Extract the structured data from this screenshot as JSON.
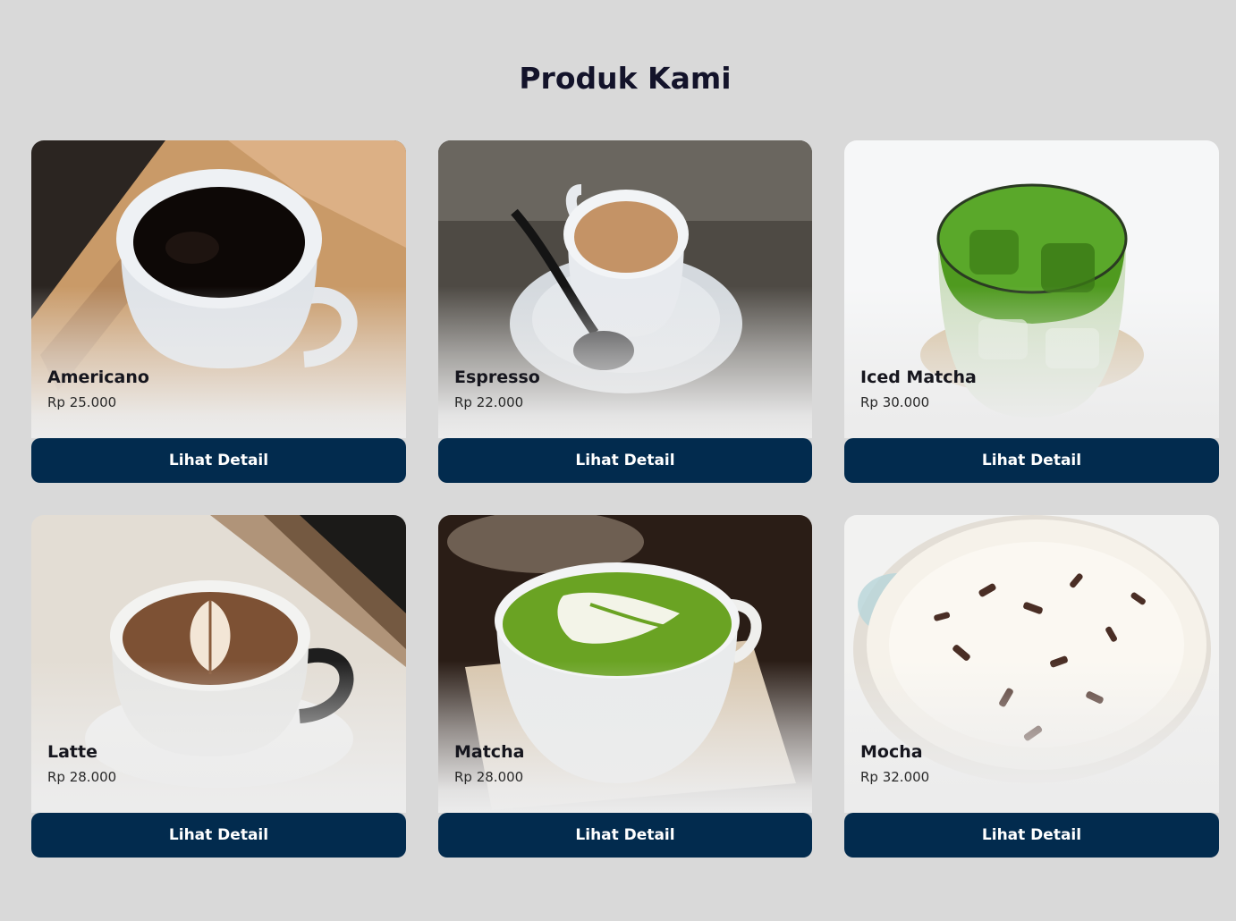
{
  "page": {
    "title": "Produk Kami"
  },
  "products": [
    {
      "name": "Americano",
      "price": "Rp 25.000",
      "button": "Lihat Detail",
      "image": "americano-cup-photo"
    },
    {
      "name": "Espresso",
      "price": "Rp 22.000",
      "button": "Lihat Detail",
      "image": "espresso-cup-photo"
    },
    {
      "name": "Iced Matcha",
      "price": "Rp 30.000",
      "button": "Lihat Detail",
      "image": "iced-matcha-glass-photo"
    },
    {
      "name": "Latte",
      "price": "Rp 28.000",
      "button": "Lihat Detail",
      "image": "latte-art-cup-photo"
    },
    {
      "name": "Matcha",
      "price": "Rp 28.000",
      "button": "Lihat Detail",
      "image": "matcha-latte-cup-photo"
    },
    {
      "name": "Mocha",
      "price": "Rp 32.000",
      "button": "Lihat Detail",
      "image": "mocha-whipped-cream-photo"
    }
  ],
  "colors": {
    "background": "#d9d9d9",
    "button": "#022b4e",
    "button_text": "#ffffff",
    "title": "#13132a"
  }
}
